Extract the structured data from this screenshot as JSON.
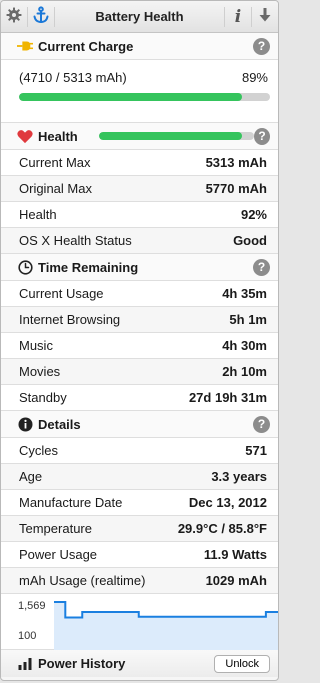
{
  "toolbar": {
    "title": "Battery Health",
    "icons": [
      "gear-icon",
      "anchor-icon",
      "info-icon",
      "download-arrow-icon"
    ]
  },
  "current_charge": {
    "title": "Current Charge",
    "help": "?",
    "detail": "(4710 / 5313 mAh)",
    "percent": "89%",
    "fill_fraction": 0.89,
    "color": "#35c45d"
  },
  "health": {
    "title": "Health",
    "help": "?",
    "fill_fraction": 0.92,
    "color": "#35c45d",
    "heart_color": "#e03a3e",
    "rows": [
      {
        "label": "Current Max",
        "value": "5313 mAh"
      },
      {
        "label": "Original Max",
        "value": "5770 mAh"
      },
      {
        "label": "Health",
        "value": "92%"
      },
      {
        "label": "OS X Health Status",
        "value": "Good"
      }
    ]
  },
  "time_remaining": {
    "title": "Time Remaining",
    "help": "?",
    "rows": [
      {
        "label": "Current Usage",
        "value": "4h 35m"
      },
      {
        "label": "Internet Browsing",
        "value": "5h 1m"
      },
      {
        "label": "Music",
        "value": "4h 30m"
      },
      {
        "label": "Movies",
        "value": "2h 10m"
      },
      {
        "label": "Standby",
        "value": "27d 19h 31m"
      }
    ]
  },
  "details": {
    "title": "Details",
    "help": "?",
    "rows": [
      {
        "label": "Cycles",
        "value": "571"
      },
      {
        "label": "Age",
        "value": "3.3 years"
      },
      {
        "label": "Manufacture Date",
        "value": "Dec 13, 2012"
      },
      {
        "label": "Temperature",
        "value": "29.9°C / 85.8°F"
      },
      {
        "label": "Power Usage",
        "value": "11.9 Watts"
      },
      {
        "label": "mAh Usage (realtime)",
        "value": "1029 mAh"
      }
    ]
  },
  "chart_data": {
    "type": "area",
    "y_tick_labels": [
      "1,569",
      "100"
    ],
    "ylim": [
      100,
      1569
    ],
    "values": [
      1569,
      1569,
      1569,
      1569,
      1000,
      1000,
      1000,
      1000,
      1000,
      1000,
      1200,
      1200,
      1200,
      1200,
      1200,
      1200,
      1200,
      1200,
      1200,
      1200,
      1200,
      1200,
      1200,
      1200,
      1200,
      1200,
      1200,
      1200,
      1200,
      1200,
      1029,
      1029,
      1029,
      1029,
      1029,
      1029,
      1029,
      1029,
      1029,
      1029,
      1029,
      1029,
      1029,
      1029,
      1029,
      1029,
      1029,
      1029,
      1029,
      1029,
      1029,
      1029,
      1029,
      1029,
      1029,
      1029,
      1029,
      1029,
      1029,
      1029,
      1029,
      1029,
      1029,
      1029,
      1029,
      1029,
      1029,
      1029,
      1029,
      1029,
      1029,
      1029,
      1029,
      1029,
      1029,
      1200,
      1200,
      1200,
      1200,
      1200
    ],
    "line_color": "#1a7fe0",
    "fill_color": "#dcebfb"
  },
  "footer": {
    "title": "Power History",
    "unlock_label": "Unlock"
  }
}
